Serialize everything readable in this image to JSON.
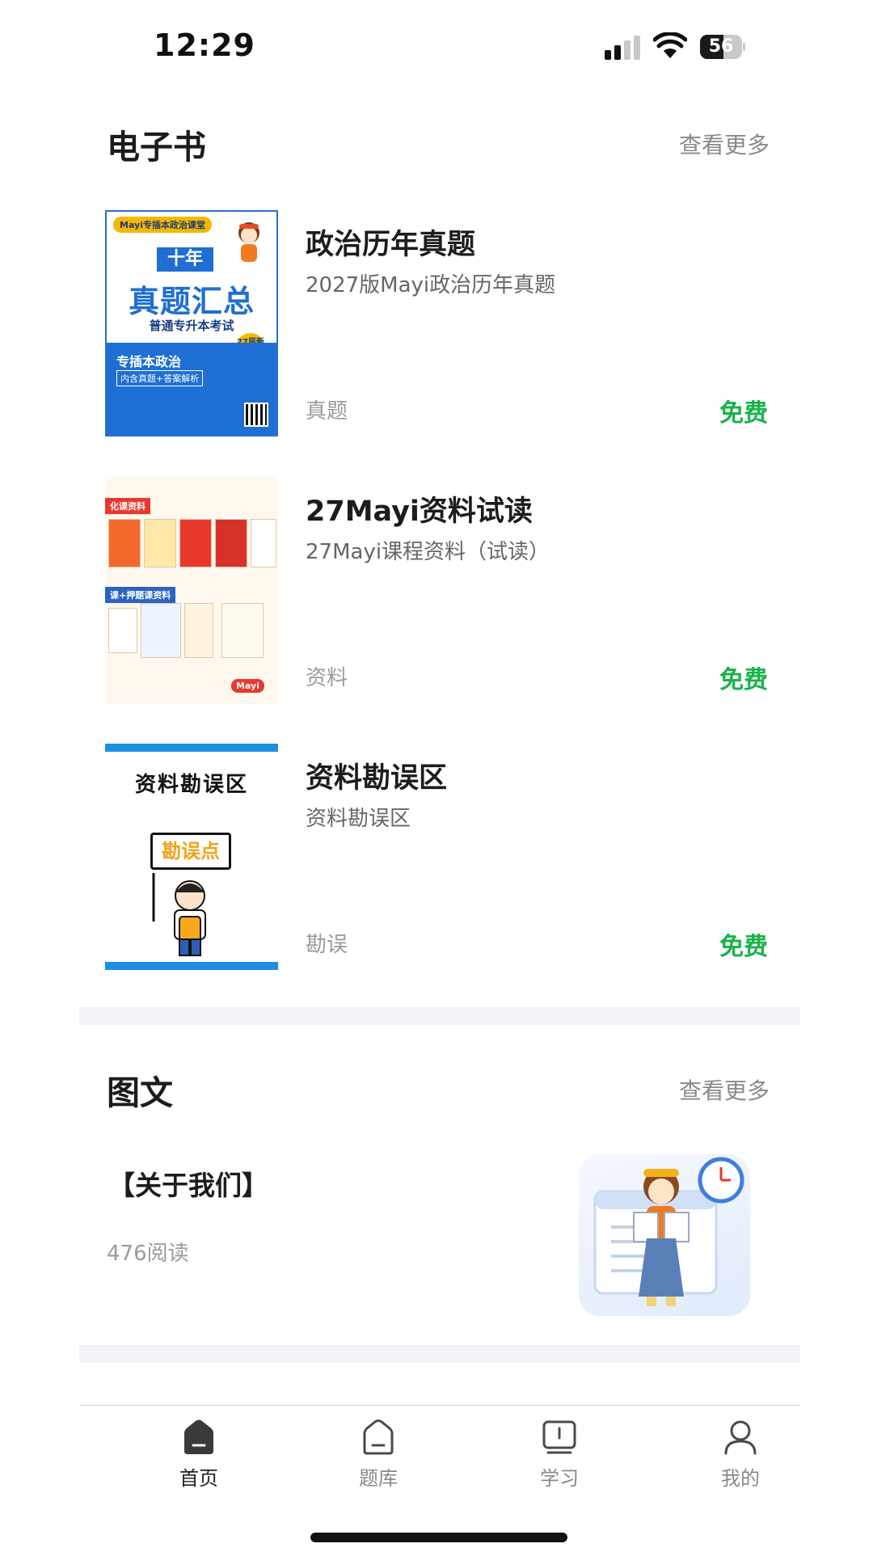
{
  "status_bar": {
    "time": "12:29",
    "battery_level": "56"
  },
  "ebooks": {
    "section_title": "电子书",
    "more_label": "查看更多",
    "items": [
      {
        "title": "政治历年真题",
        "subtitle": "2027版Mayi政治历年真题",
        "tag": "真题",
        "price": "免费",
        "cover": {
          "brand_pill": "Mayi专插本政治课堂",
          "year_text": "十年",
          "big_text": "真题汇总",
          "exam_text": "普通专升本考试",
          "subject_text": "专插本政治",
          "note_text": "内含真题+答案解析",
          "edition_badge": "27届新版"
        }
      },
      {
        "title": "27Mayi资料试读",
        "subtitle": "27Mayi课程资料（试读）",
        "tag": "资料",
        "price": "免费",
        "cover": {
          "label_top": "化课资料",
          "label_mid": "课+押题课资料"
        }
      },
      {
        "title": "资料勘误区",
        "subtitle": "资料勘误区",
        "tag": "勘误",
        "price": "免费",
        "cover": {
          "heading": "资料勘误区",
          "sign": "勘误点"
        }
      }
    ]
  },
  "articles": {
    "section_title": "图文",
    "more_label": "查看更多",
    "items": [
      {
        "title": "【关于我们】",
        "reads": "476阅读"
      }
    ]
  },
  "tabbar": {
    "tabs": [
      {
        "label": "首页",
        "icon": "home-filled-icon",
        "active": true
      },
      {
        "label": "题库",
        "icon": "home-outline-icon",
        "active": false
      },
      {
        "label": "学习",
        "icon": "monitor-icon",
        "active": false
      },
      {
        "label": "我的",
        "icon": "user-icon",
        "active": false
      }
    ]
  },
  "colors": {
    "price": "#19b34a",
    "accent_blue": "#1f6ed4",
    "separator": "#f1f3f6"
  }
}
